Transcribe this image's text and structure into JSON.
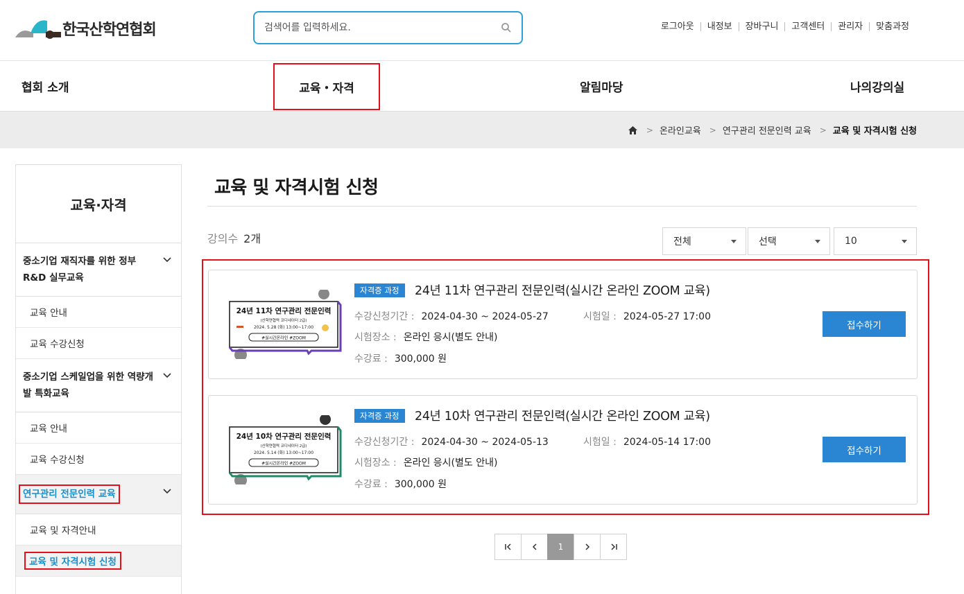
{
  "header": {
    "logo_text": "한국산학연협회",
    "search_placeholder": "검색어를 입력하세요.",
    "util_links": [
      "로그아웃",
      "내정보",
      "장바구니",
      "고객센터",
      "관리자",
      "맞춤과정"
    ]
  },
  "gnb": [
    "협회 소개",
    "교육・자격",
    "알림마당",
    "나의강의실"
  ],
  "breadcrumb": [
    "온라인교육",
    "연구관리 전문인력 교육",
    "교육 및 자격시험 신청"
  ],
  "sidebar": {
    "title": "교육·자격",
    "cat1": "중소기업 재직자를 위한 정부 R&D 실무교육",
    "cat1_sub": [
      "교육 안내",
      "교육 수강신청"
    ],
    "cat2": "중소기업 스케일업을 위한 역량개발 특화교육",
    "cat2_sub": [
      "교육 안내",
      "교육 수강신청"
    ],
    "cat3": "연구관리 전문인력 교육",
    "cat3_sub": [
      "교육 및 자격안내",
      "교육 및 자격시험 신청"
    ]
  },
  "main": {
    "title": "교육 및 자격시험 신청",
    "count_label": "강의수",
    "count_value": "2개",
    "filters": [
      "전체",
      "선택",
      "10"
    ]
  },
  "labels": {
    "period": "수강신청기간 :",
    "exam_date": "시험일 :",
    "location": "시험장소 :",
    "fee": "수강료 :",
    "apply": "접수하기"
  },
  "courses": [
    {
      "badge": "자격증 과정",
      "title": "24년 11차 연구관리 전문인력(실시간 온라인 ZOOM 교육)",
      "period": "2024-04-30 ~ 2024-05-27",
      "exam_date": "2024-05-27 17:00",
      "location": "온라인 응시(별도 안내)",
      "fee": "300,000 원",
      "thumb_title": "24년 11차 연구관리 전문인력",
      "thumb_sub": "(산학연협력 코디네이터 2급)",
      "thumb_date": "2024. 5.28 (화) 13:00~17:00",
      "thumb_tag": "#실시간온라인 #ZOOM",
      "accent": "#6a3fb5"
    },
    {
      "badge": "자격증 과정",
      "title": "24년 10차 연구관리 전문인력(실시간 온라인 ZOOM 교육)",
      "period": "2024-04-30 ~ 2024-05-13",
      "exam_date": "2024-05-14 17:00",
      "location": "온라인 응시(별도 안내)",
      "fee": "300,000 원",
      "thumb_title": "24년 10차 연구관리 전문인력",
      "thumb_sub": "(산학연협력 코디네이터 2급)",
      "thumb_date": "2024. 5.14 (화) 13:00~17:00",
      "thumb_tag": "#실시간온라인 #ZOOM",
      "accent": "#1f8a6a"
    }
  ],
  "pager": {
    "current": "1"
  }
}
